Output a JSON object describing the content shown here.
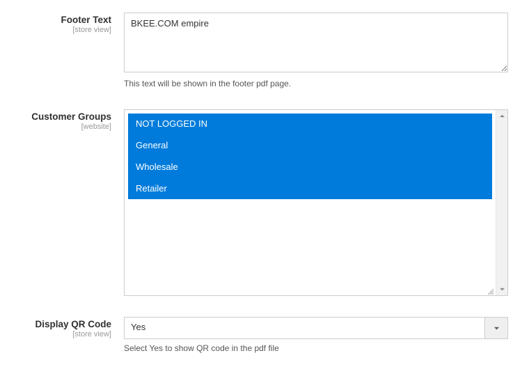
{
  "footer_text": {
    "label": "Footer Text",
    "scope": "[store view]",
    "value": "BKEE.COM empire",
    "help": "This text will be shown in the footer pdf page."
  },
  "customer_groups": {
    "label": "Customer Groups",
    "scope": "[website]",
    "options": [
      "NOT LOGGED IN",
      "General",
      "Wholesale",
      "Retailer"
    ]
  },
  "display_qr": {
    "label": "Display QR Code",
    "scope": "[store view]",
    "value": "Yes",
    "help": "Select Yes to show QR code in the pdf file"
  }
}
